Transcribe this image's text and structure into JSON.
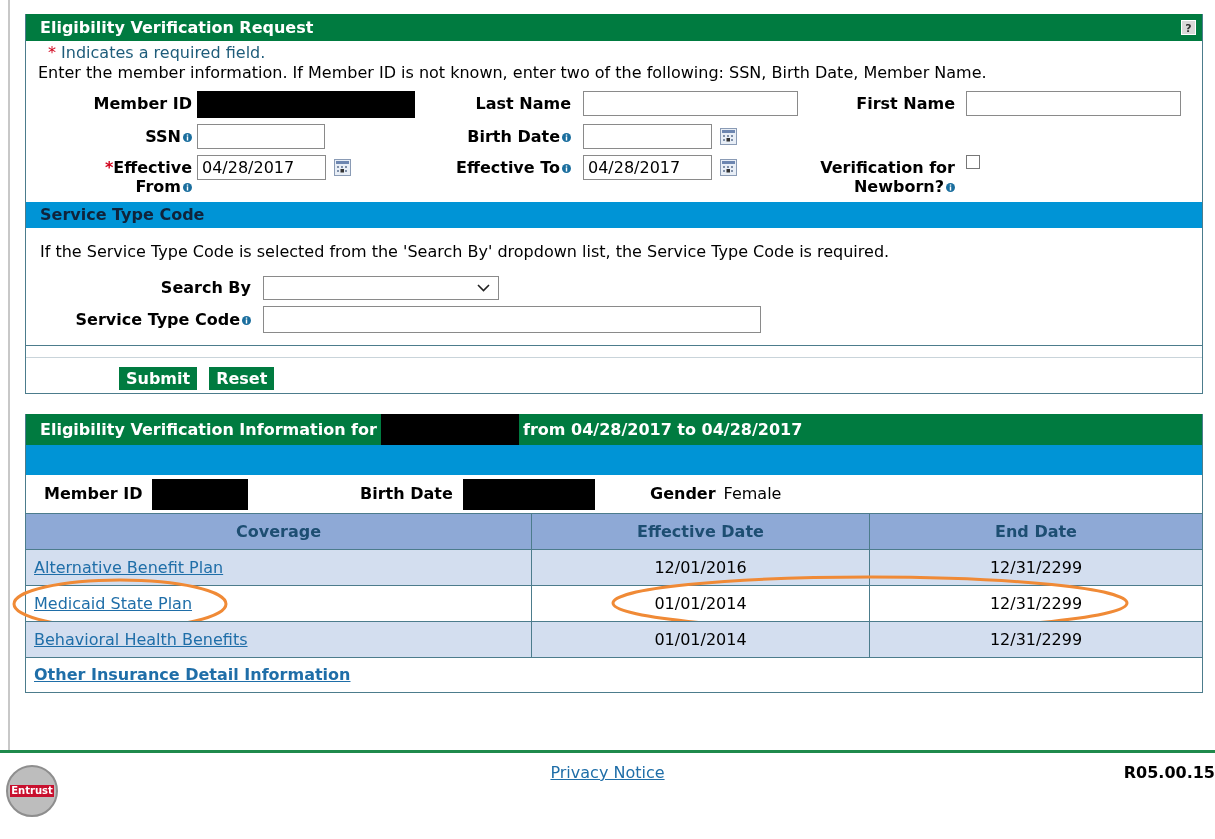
{
  "request_panel": {
    "title": "Eligibility Verification Request",
    "help_button": "?",
    "required_note": {
      "mark": "*",
      "text": "Indicates a required field."
    },
    "instructions": "Enter the member information. If Member ID is not known, enter two of the following: SSN, Birth Date, Member Name.",
    "fields": [
      {
        "label": "Member ID",
        "kind": "redacted",
        "info": false
      },
      {
        "label": "Last Name",
        "kind": "text",
        "info": false
      },
      {
        "label": "First Name",
        "kind": "text",
        "info": false
      },
      {
        "label": "SSN",
        "kind": "short",
        "info": true
      },
      {
        "label": "Birth Date",
        "kind": "date",
        "info": true
      },
      {
        "kind": "empty"
      },
      {
        "label": "Effective From",
        "required_mark": "*",
        "kind": "date",
        "info": true,
        "value": "04/28/2017"
      },
      {
        "label": "Effective To",
        "kind": "date",
        "info": true,
        "value": "04/28/2017"
      },
      {
        "label": "Verification for Newborn?",
        "kind": "checkbox",
        "info": true,
        "checked": false
      }
    ]
  },
  "service_type": {
    "title": "Service Type Code",
    "note": "If the Service Type Code is selected from the 'Search By' dropdown list, the Service Type Code is required.",
    "fields": [
      {
        "label": "Search By",
        "kind": "select",
        "info": false
      },
      {
        "label": "Service Type Code",
        "kind": "text",
        "info": true
      }
    ]
  },
  "buttons": [
    "Submit",
    "Reset"
  ],
  "info_panel": {
    "title_prefix": "Eligibility Verification Information for",
    "title_redacted": true,
    "title_suffix": "from 04/28/2017 to 04/28/2017",
    "member": [
      {
        "label": "Member ID",
        "redacted": true
      },
      {
        "label": "Birth Date",
        "redacted": true
      },
      {
        "label": "Gender",
        "redacted": false,
        "value": "Female"
      }
    ],
    "table": {
      "columns": [
        "Coverage",
        "Effective Date",
        "End Date"
      ],
      "rows": [
        {
          "coverage": "Alternative Benefit Plan",
          "effective_date": "12/01/2016",
          "end_date": "12/31/2299",
          "circled": false
        },
        {
          "coverage": "Medicaid State Plan",
          "effective_date": "01/01/2014",
          "end_date": "12/31/2299",
          "circled": true
        },
        {
          "coverage": "Behavioral Health Benefits",
          "effective_date": "01/01/2014",
          "end_date": "12/31/2299",
          "circled": false
        }
      ]
    },
    "other_link": "Other Insurance Detail Information"
  },
  "footer": {
    "link": "Privacy Notice",
    "version": "R05.00.15",
    "seal": "Entrust"
  }
}
